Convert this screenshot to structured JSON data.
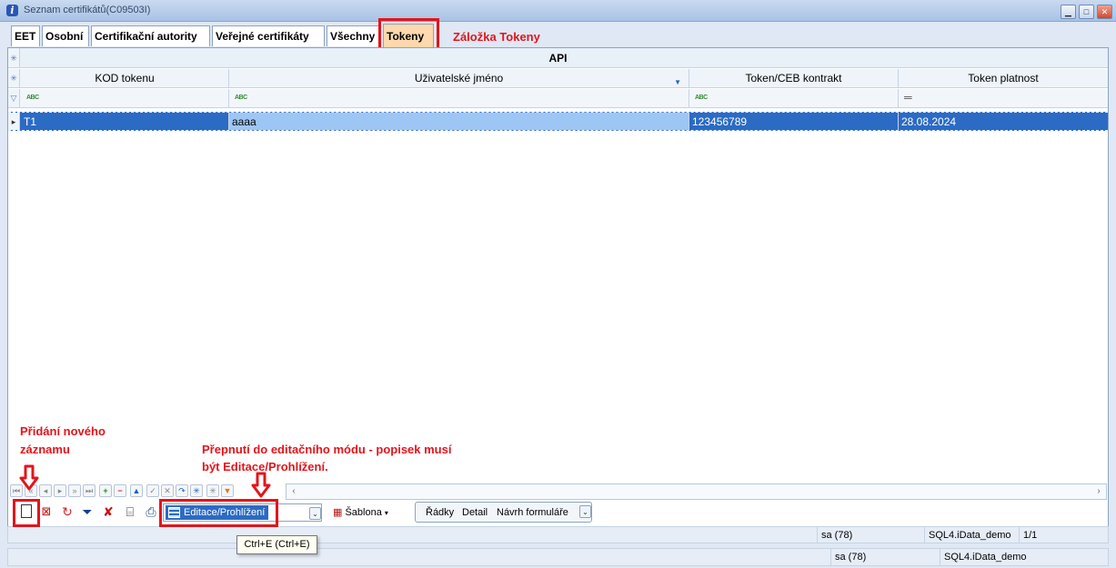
{
  "window": {
    "title": "Seznam certifikátů(C09503I)",
    "buttons": [
      "minimize",
      "maximize",
      "close"
    ]
  },
  "tabs": [
    {
      "label": "EET"
    },
    {
      "label": "Osobní"
    },
    {
      "label": "Certifikační autority"
    },
    {
      "label": "Veřejné certifikáty"
    },
    {
      "label": "Všechny"
    },
    {
      "label": "Tokeny",
      "active": true
    }
  ],
  "annotations": {
    "tab_note": "Záložka Tokeny",
    "add_note_line1": "Přidání nového",
    "add_note_line2": "záznamu",
    "mode_note_line1": "Přepnutí do editačního módu - popisek musí",
    "mode_note_line2": "být Editace/Prohlížení.",
    "color": "#e3141b"
  },
  "grid": {
    "group_header": "API",
    "columns": [
      "KOD tokenu",
      "Uživatelské jméno",
      "Token/CEB kontrakt",
      "Token platnost"
    ],
    "filter_icons": [
      "abc-filter-icon",
      "abc-filter-icon",
      "abc-filter-icon",
      "equals-filter-icon"
    ],
    "rows": [
      {
        "kod": "T1",
        "jmeno": "aaaa",
        "kontrakt": "123456789",
        "platnost": "28.08.2024"
      }
    ],
    "selection_color": "#2b6bc4"
  },
  "toolbar": {
    "mode_value": "Editace/Prohlížení",
    "template_label": "Šablona",
    "menu": [
      "Řádky",
      "Detail",
      "Návrh formuláře"
    ],
    "tooltip": "Ctrl+E (Ctrl+E)"
  },
  "status": {
    "line1": {
      "user": "sa (78)",
      "db": "SQL4.iData_demo",
      "page": "1/1"
    },
    "line2": {
      "user": "sa (78)",
      "db": "SQL4.iData_demo"
    }
  }
}
